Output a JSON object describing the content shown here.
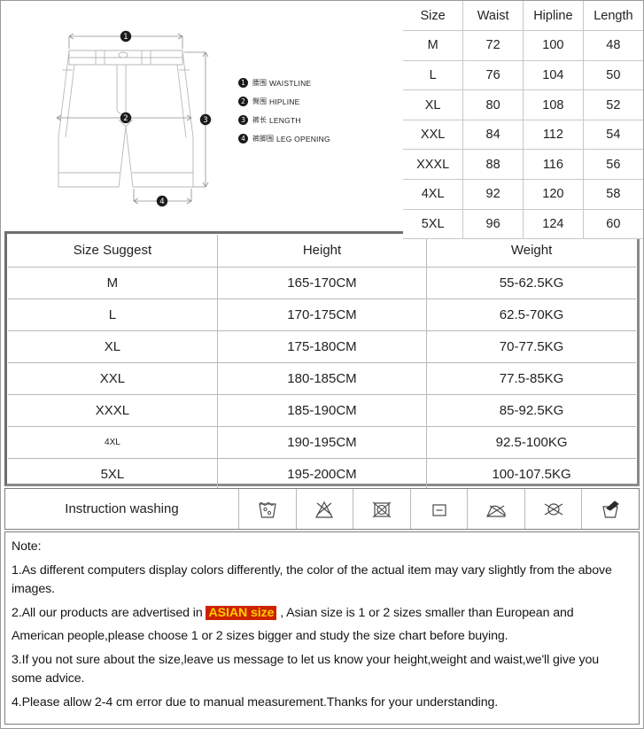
{
  "diagram": {
    "title": "shorts-measurement-diagram",
    "markers": [
      "1",
      "2",
      "3",
      "4"
    ],
    "legend": [
      {
        "num": "❶",
        "cn": "腰围",
        "en": "WAISTLINE"
      },
      {
        "num": "❷",
        "cn": "臀围",
        "en": "HIPLINE"
      },
      {
        "num": "❸",
        "cn": "裤长",
        "en": "LENGTH"
      },
      {
        "num": "❹",
        "cn": "裤脚围",
        "en": "LEG OPENING"
      }
    ]
  },
  "measure_table": {
    "headers": [
      "Size",
      "Waist",
      "Hipline",
      "Length"
    ],
    "rows": [
      [
        "M",
        "72",
        "100",
        "48"
      ],
      [
        "L",
        "76",
        "104",
        "50"
      ],
      [
        "XL",
        "80",
        "108",
        "52"
      ],
      [
        "XXL",
        "84",
        "112",
        "54"
      ],
      [
        "XXXL",
        "88",
        "116",
        "56"
      ],
      [
        "4XL",
        "92",
        "120",
        "58"
      ],
      [
        "5XL",
        "96",
        "124",
        "60"
      ]
    ]
  },
  "suggest_table": {
    "headers": [
      "Size Suggest",
      "Height",
      "Weight"
    ],
    "rows": [
      [
        "M",
        "165-170CM",
        "55-62.5KG"
      ],
      [
        "L",
        "170-175CM",
        "62.5-70KG"
      ],
      [
        "XL",
        "175-180CM",
        "70-77.5KG"
      ],
      [
        "XXL",
        "180-185CM",
        "77.5-85KG"
      ],
      [
        "XXXL",
        "185-190CM",
        "85-92.5KG"
      ],
      [
        "4XL",
        "190-195CM",
        "92.5-100KG"
      ],
      [
        "5XL",
        "195-200CM",
        "100-107.5KG"
      ]
    ]
  },
  "washing": {
    "label": "Instruction washing",
    "icons": [
      "machine-wash-icon",
      "do-not-bleach-icon",
      "do-not-tumble-dry-icon",
      "dry-flat-icon",
      "iron-icon",
      "do-not-dry-clean-icon",
      "hand-wash-brush-icon"
    ]
  },
  "note": {
    "title": "Note:",
    "line1": "1.As different computers display colors differently, the color of the actual item may vary slightly from the above images.",
    "line2_before": "2.All our products are advertised in ",
    "line2_highlight": "ASIAN size",
    "line2_after": " , Asian size is 1 or 2 sizes smaller than European and",
    "line3": "American people,please choose 1 or 2 sizes bigger and study the size chart before buying.",
    "line4": "3.If you not sure about the size,leave us message to let us know your height,weight and waist,we'll give you some advice.",
    "line5": "4.Please allow 2-4 cm error due to manual measurement.Thanks for your understanding."
  },
  "colors": {
    "highlight_bg": "#cc2200",
    "highlight_text": "#ffcc00",
    "frame": "#8a8a8a",
    "grid": "#c8c8c8"
  }
}
